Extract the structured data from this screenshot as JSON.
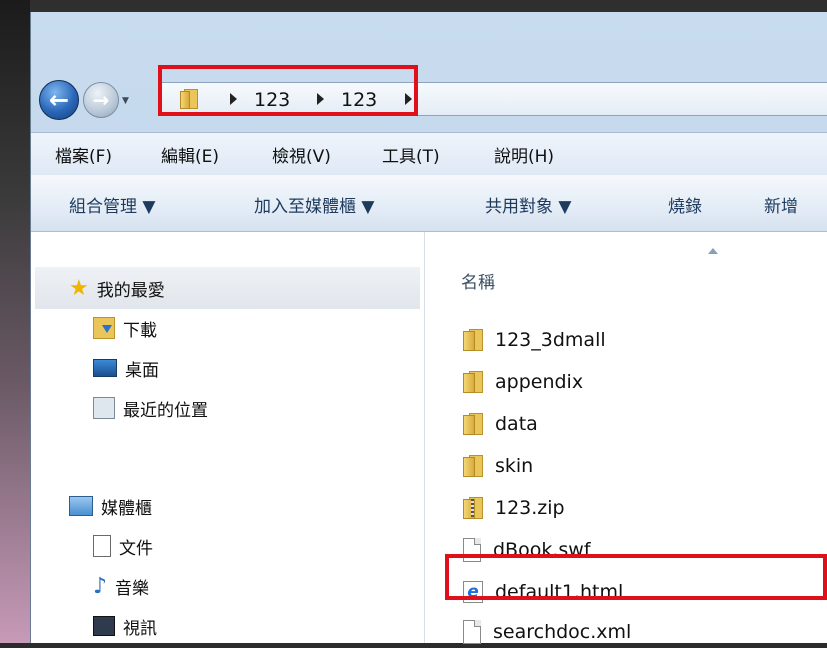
{
  "address": {
    "crumbs": [
      "123",
      "123"
    ]
  },
  "menu": [
    "檔案(F)",
    "編輯(E)",
    "檢視(V)",
    "工具(T)",
    "說明(H)"
  ],
  "toolbar": {
    "organize": "組合管理 ▼",
    "library": "加入至媒體櫃 ▼",
    "share": "共用對象 ▼",
    "burn": "燒錄",
    "new": "新增"
  },
  "nav": {
    "favorites": "我的最愛",
    "downloads": "下載",
    "desktop": "桌面",
    "recent": "最近的位置",
    "libraries": "媒體櫃",
    "documents": "文件",
    "music": "音樂",
    "videos": "視訊"
  },
  "files": {
    "column_name": "名稱",
    "items": [
      "123_3dmall",
      "appendix",
      "data",
      "skin",
      "123.zip",
      "dBook.swf",
      "default1.html",
      "searchdoc.xml"
    ]
  },
  "colors": {
    "highlight": "#e0101a",
    "folder": "#e9c55a"
  }
}
